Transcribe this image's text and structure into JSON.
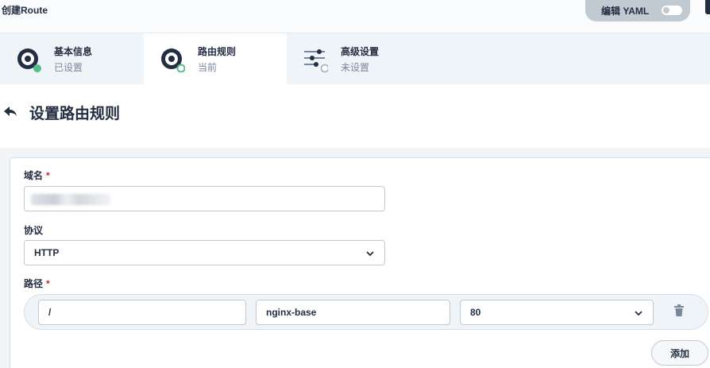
{
  "header": {
    "title": "创建Route",
    "yaml_button": "编辑 YAML"
  },
  "steps": [
    {
      "title": "基本信息",
      "subtitle": "已设置",
      "icon": "disk-icon",
      "status": "done"
    },
    {
      "title": "路由规则",
      "subtitle": "当前",
      "icon": "disk-icon",
      "status": "current"
    },
    {
      "title": "高级设置",
      "subtitle": "未设置",
      "icon": "sliders-icon",
      "status": "pending"
    }
  ],
  "section": {
    "title": "设置路由规则"
  },
  "form": {
    "domain_label": "域名",
    "required_mark": "*",
    "domain_value_redacted": "",
    "protocol_label": "协议",
    "protocol_value": "HTTP",
    "path_label": "路径",
    "path_rows": [
      {
        "path": "/",
        "service": "nginx-base",
        "port": "80"
      }
    ],
    "add_button": "添加"
  },
  "colors": {
    "done_dot": "#55bc8a",
    "current_ring": "#55bc8a",
    "text_dark": "#242e42",
    "text_muted": "#79879c",
    "required": "#ca2621"
  }
}
